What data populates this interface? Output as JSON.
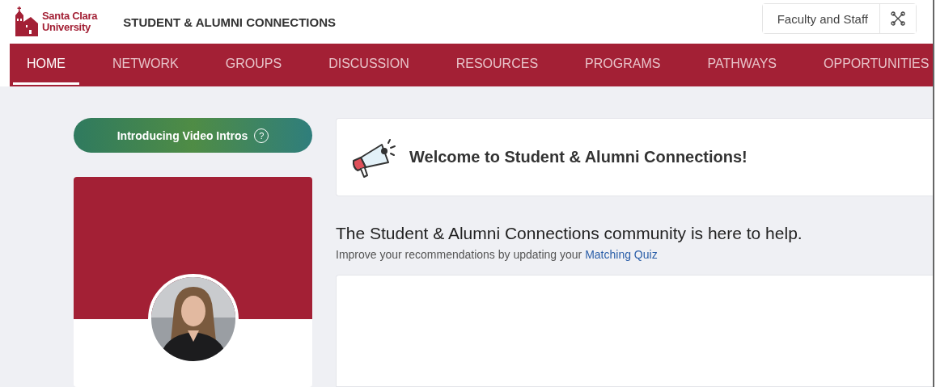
{
  "header": {
    "logo": {
      "line_1": "Santa Clara",
      "line_2": "University"
    },
    "title": "STUDENT & ALUMNI CONNECTIONS",
    "role_button": "Faculty and Staff"
  },
  "nav": [
    {
      "label": "HOME",
      "selected": true
    },
    {
      "label": "NETWORK",
      "selected": false
    },
    {
      "label": "GROUPS",
      "selected": false
    },
    {
      "label": "DISCUSSION",
      "selected": false
    },
    {
      "label": "RESOURCES",
      "selected": false
    },
    {
      "label": "PROGRAMS",
      "selected": false
    },
    {
      "label": "PATHWAYS",
      "selected": false
    },
    {
      "label": "OPPORTUNITIES",
      "selected": false
    }
  ],
  "sidebar": {
    "video_intros_button": "Introducing Video Intros",
    "help_icon": "?"
  },
  "welcome": {
    "title": "Welcome to Student & Alumni Connections!"
  },
  "intro": {
    "heading": "The Student & Alumni Connections community is here to help.",
    "text": "Improve your recommendations by updating your ",
    "link": "Matching Quiz"
  }
}
